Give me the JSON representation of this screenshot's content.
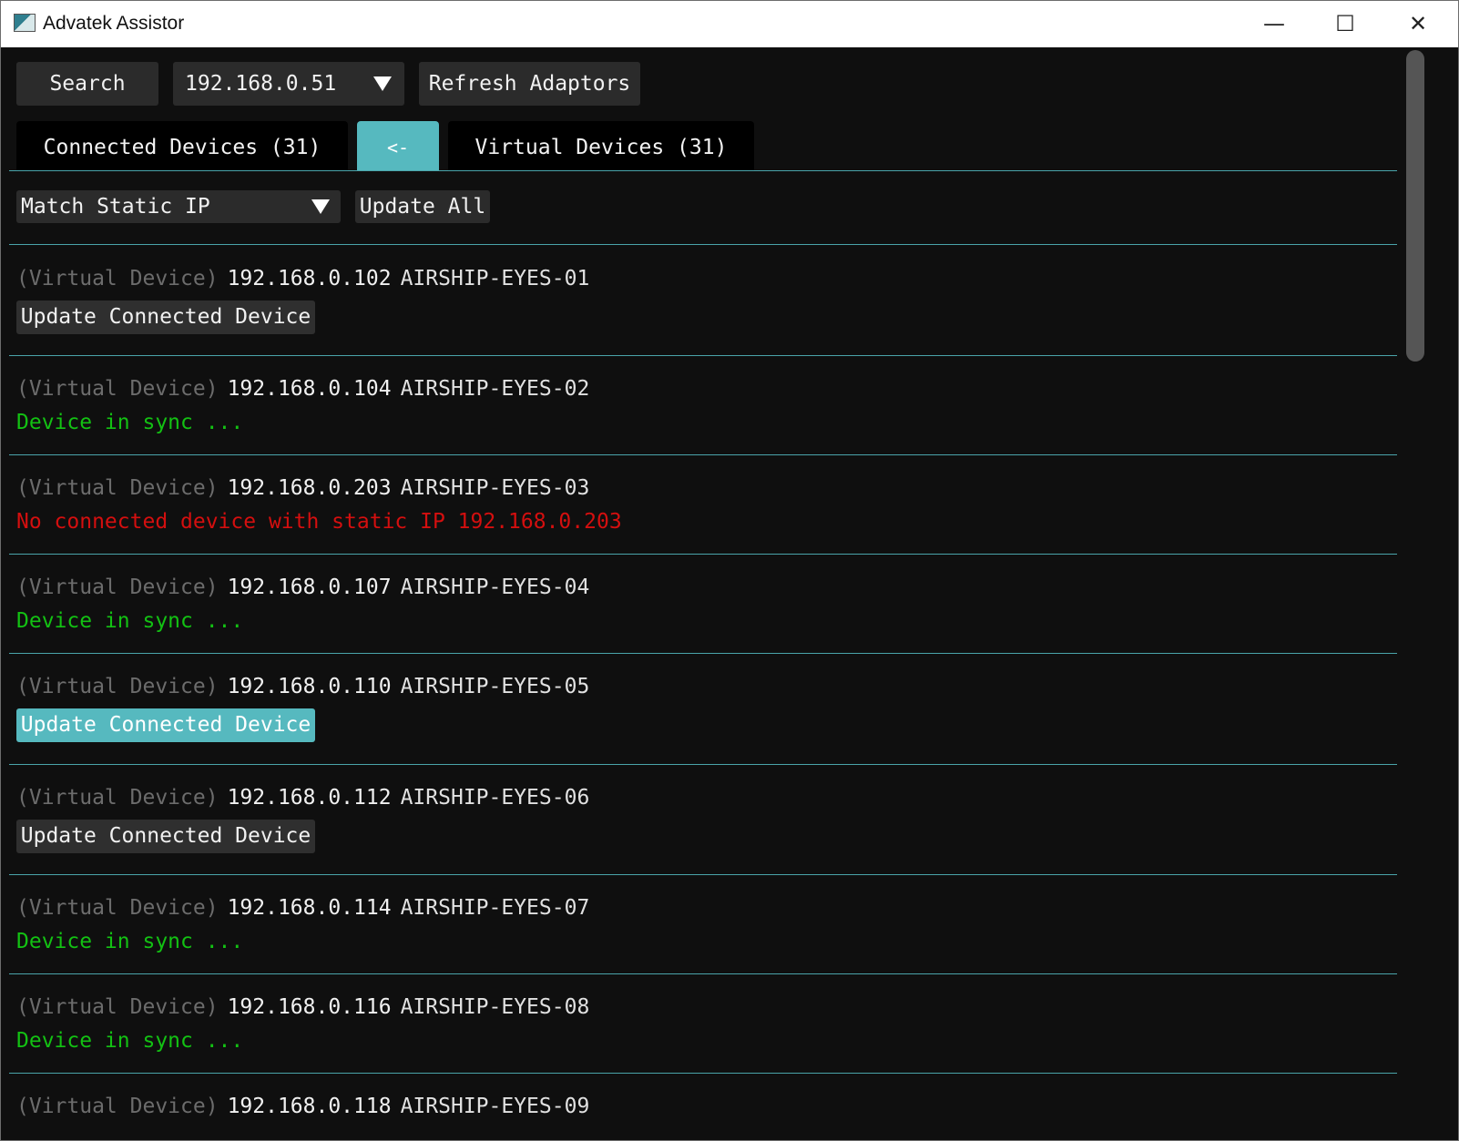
{
  "window": {
    "title": "Advatek Assistor",
    "controls": {
      "minimize": "—",
      "maximize": "☐",
      "close": "✕"
    }
  },
  "toolbar": {
    "search_label": "Search",
    "adaptor_value": "192.168.0.51",
    "refresh_label": "Refresh Adaptors"
  },
  "tabs": {
    "connected": "Connected Devices (31)",
    "back": "<-",
    "virtual": "Virtual Devices (31)"
  },
  "actions": {
    "filter_value": "Match Static IP",
    "update_all_label": "Update All"
  },
  "device_prefix": "(Virtual Device)",
  "devices": [
    {
      "ip": "192.168.0.102",
      "name": "AIRSHIP-EYES-01",
      "status_type": "button",
      "status": "Update Connected Device"
    },
    {
      "ip": "192.168.0.104",
      "name": "AIRSHIP-EYES-02",
      "status_type": "ok",
      "status": "Device in sync ..."
    },
    {
      "ip": "192.168.0.203",
      "name": "AIRSHIP-EYES-03",
      "status_type": "error",
      "status": "No connected device with static IP 192.168.0.203"
    },
    {
      "ip": "192.168.0.107",
      "name": "AIRSHIP-EYES-04",
      "status_type": "ok",
      "status": "Device in sync ..."
    },
    {
      "ip": "192.168.0.110",
      "name": "AIRSHIP-EYES-05",
      "status_type": "button-active",
      "status": "Update Connected Device"
    },
    {
      "ip": "192.168.0.112",
      "name": "AIRSHIP-EYES-06",
      "status_type": "button",
      "status": "Update Connected Device"
    },
    {
      "ip": "192.168.0.114",
      "name": "AIRSHIP-EYES-07",
      "status_type": "ok",
      "status": "Device in sync ..."
    },
    {
      "ip": "192.168.0.116",
      "name": "AIRSHIP-EYES-08",
      "status_type": "ok",
      "status": "Device in sync ..."
    },
    {
      "ip": "192.168.0.118",
      "name": "AIRSHIP-EYES-09",
      "status_type": "partial",
      "status": ""
    }
  ],
  "colors": {
    "accent": "#56b9bf",
    "background": "#0f0f0f",
    "sync_green": "#13c113",
    "error_red": "#d40f0f",
    "muted": "#6c6c6c"
  }
}
